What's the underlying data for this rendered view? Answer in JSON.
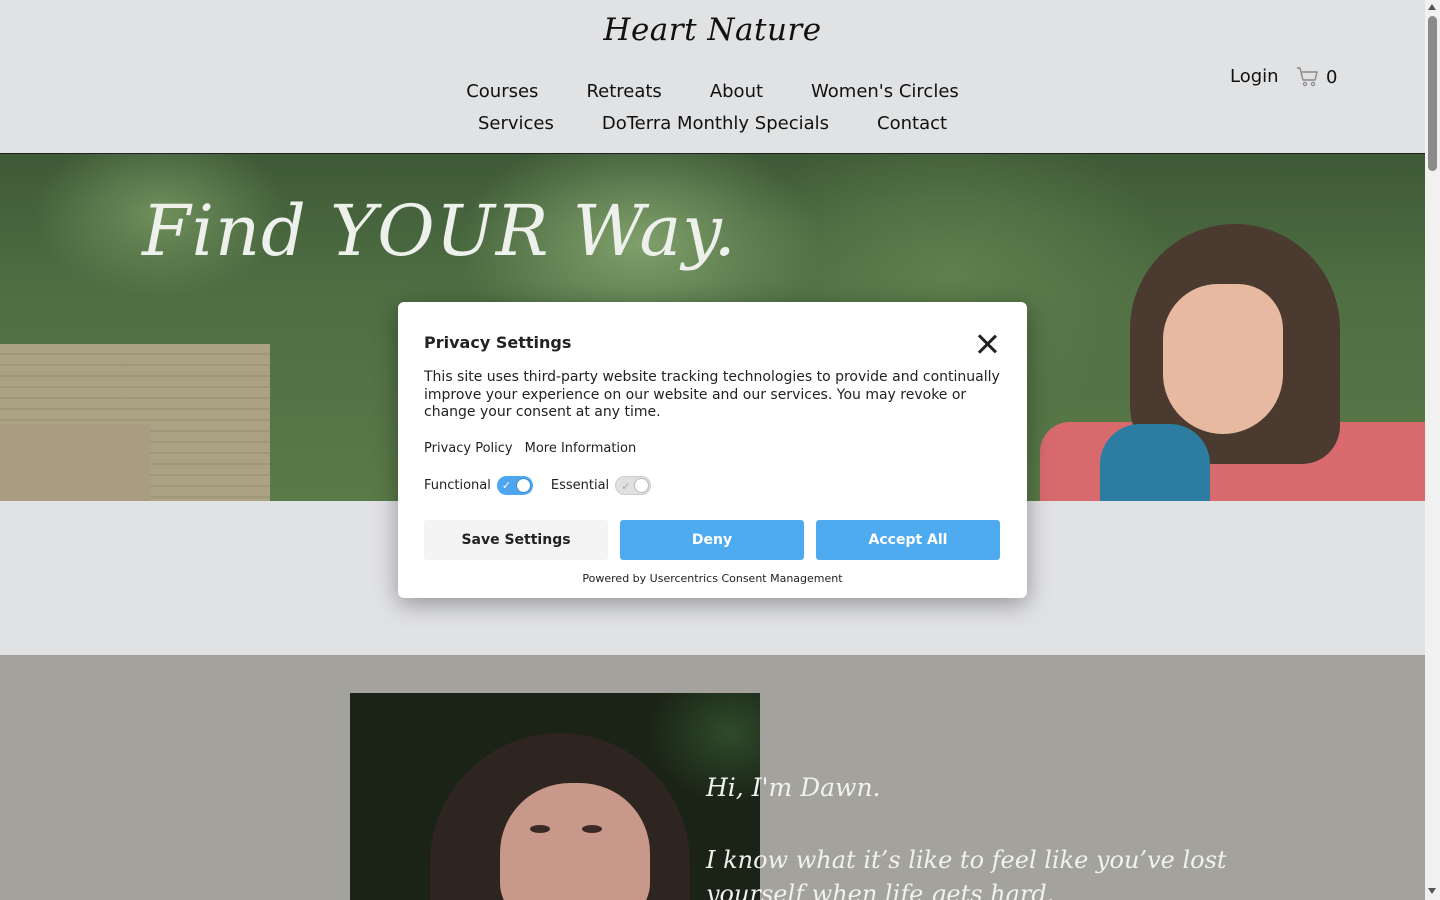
{
  "header": {
    "site_title": "Heart Nature",
    "nav_row1": [
      "Courses",
      "Retreats",
      "About",
      "Women's Circles"
    ],
    "nav_row2": [
      "Services",
      "DoTerra Monthly Specials",
      "Contact"
    ],
    "login_label": "Login",
    "cart_count": "0",
    "cart_icon": "shopping-cart-icon"
  },
  "hero": {
    "headline": "Find YOUR Way."
  },
  "about": {
    "greeting": "Hi, I'm Dawn.",
    "body": "I know what it’s like to feel like you’ve lost yourself when life gets hard."
  },
  "consent_modal": {
    "title": "Privacy Settings",
    "description": "This site uses third-party website tracking technologies to provide and continually improve your experience on our website and our services. You may revoke or change your consent at any time.",
    "links": {
      "privacy_policy": "Privacy Policy",
      "more_information": "More Information"
    },
    "toggles": {
      "functional": {
        "label": "Functional",
        "checked": true
      },
      "essential": {
        "label": "Essential",
        "checked": true,
        "disabled": true
      }
    },
    "buttons": {
      "save": "Save Settings",
      "deny": "Deny",
      "accept": "Accept All"
    },
    "powered_by": "Powered by Usercentrics Consent Management",
    "colors": {
      "primary": "#4fabf0",
      "secondary": "#f4f4f4"
    }
  }
}
